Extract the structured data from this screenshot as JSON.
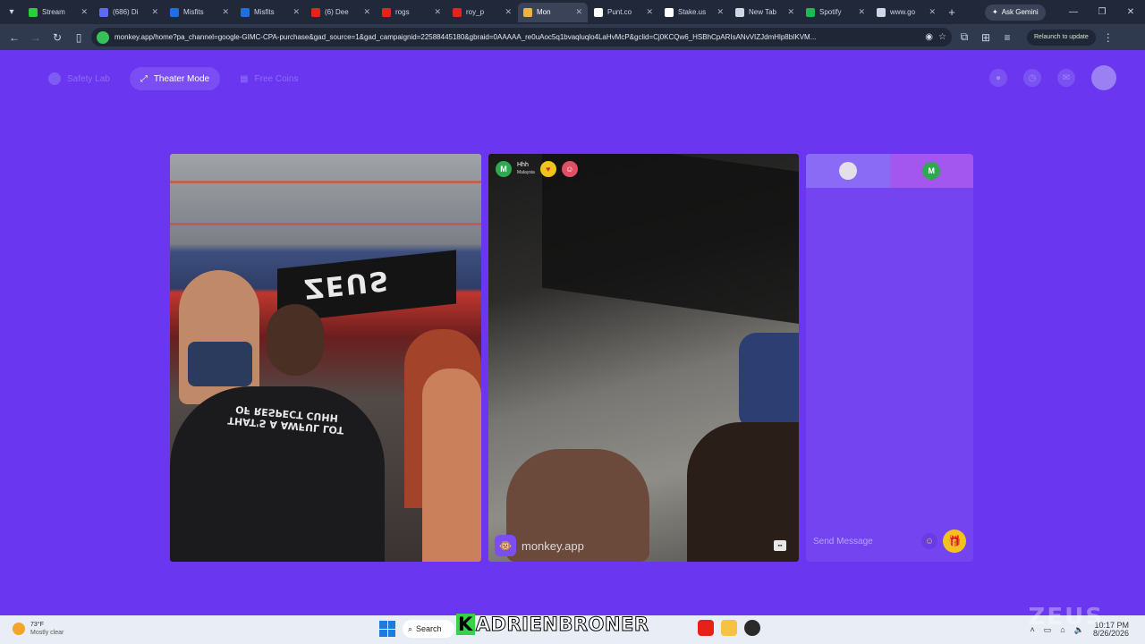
{
  "browser": {
    "tabs": [
      {
        "title": "Stream",
        "color": "#2ecc40",
        "active": false
      },
      {
        "title": "(686) Di",
        "color": "#5b6cf0",
        "active": false
      },
      {
        "title": "Misfits",
        "color": "#1f6fe0",
        "active": false
      },
      {
        "title": "Misfits",
        "color": "#1f6fe0",
        "active": false
      },
      {
        "title": "(6) Dee",
        "color": "#e0251b",
        "active": false
      },
      {
        "title": "rogs",
        "color": "#e0251b",
        "active": false
      },
      {
        "title": "roy_p",
        "color": "#e0251b",
        "active": false
      },
      {
        "title": "Mon",
        "color": "#f0b14a",
        "active": true
      },
      {
        "title": "Punt.co",
        "color": "#ffffff",
        "active": false
      },
      {
        "title": "Stake.us",
        "color": "#ffffff",
        "active": false
      },
      {
        "title": "New Tab",
        "color": "#cfd6e4",
        "active": false
      },
      {
        "title": "Spotify",
        "color": "#1db954",
        "active": false
      },
      {
        "title": "www.go",
        "color": "#cfd6e4",
        "active": false
      }
    ],
    "ask_gemini_label": "Ask Gemini",
    "url": "monkey.app/home?pa_channel=google-GIMC-CPA-purchase&gad_source=1&gad_campaignid=22588445180&gbraid=0AAAAA_re0uAoc5q1bvaqluqlo4LaHvMcP&gclid=Cj0KCQw6_HSBhCpARIsANvVIZJdmHlp8bIKVM...",
    "relaunch_label": "Relaunch to update"
  },
  "monkey": {
    "nav": {
      "safety_lab": "Safety Lab",
      "theater_mode": "Theater Mode",
      "free_coins": "Free Coins"
    },
    "peer": {
      "avatar_letter": "M",
      "name": "Hhh",
      "country": "Malaysia"
    },
    "watermark": "monkey.app",
    "chat": {
      "peer_letter": "M",
      "placeholder": "Send Message"
    },
    "left_video": {
      "banner_text": "ZEUS",
      "shirt_text": "THAT'S A AWFUL LOT OF RESPECT CUHH"
    }
  },
  "taskbar": {
    "weather_temp": "73°F",
    "weather_desc": "Mostly clear",
    "search_label": "Search",
    "overlay_prefix": "K",
    "overlay_name": "ADRIENBRONER",
    "time": "10:17 PM",
    "date": "8/26/2026"
  },
  "colors": {
    "page_bg": "#6a36f0",
    "chat_bg": "#7444f1",
    "accent_green": "#39d04a"
  }
}
